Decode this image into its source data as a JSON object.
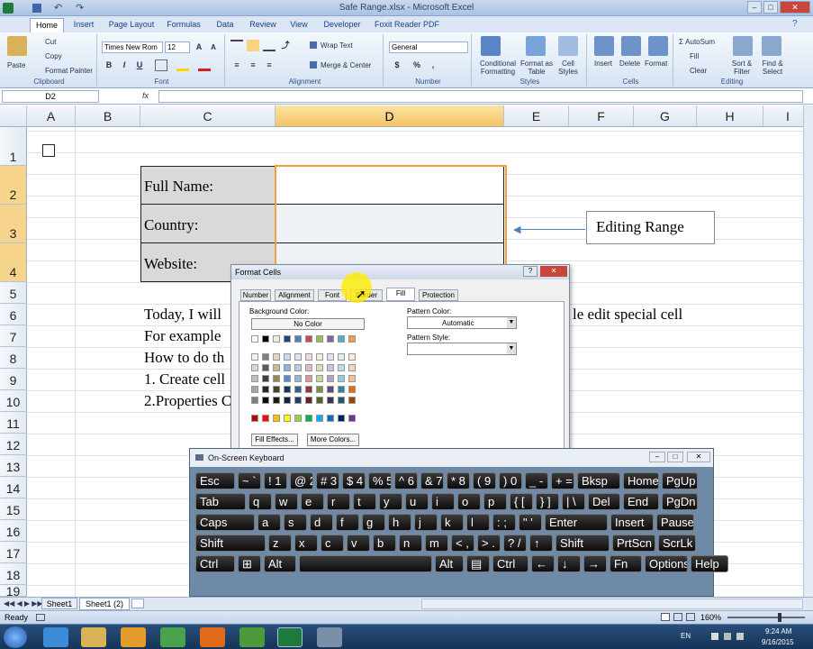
{
  "window": {
    "title": "Safe Range.xlsx - Microsoft Excel",
    "min": "–",
    "max": "□",
    "close": "✕"
  },
  "ribbon_tabs": [
    "Home",
    "Insert",
    "Page Layout",
    "Formulas",
    "Data",
    "Review",
    "View",
    "Developer",
    "Foxit Reader PDF"
  ],
  "ribbon": {
    "clipboard": {
      "paste": "Paste",
      "cut": "Cut",
      "copy": "Copy",
      "format_painter": "Format Painter",
      "label": "Clipboard"
    },
    "font": {
      "name": "Times New Rom",
      "size": "12",
      "bold": "B",
      "italic": "I",
      "underline": "U",
      "label": "Font",
      "grow": "A",
      "shrink": "A"
    },
    "alignment": {
      "wrap": "Wrap Text",
      "merge": "Merge & Center",
      "label": "Alignment"
    },
    "number": {
      "format": "General",
      "dollar": "$",
      "percent": "%",
      "comma": ",",
      "label": "Number"
    },
    "styles": {
      "conditional": "Conditional Formatting",
      "format_table": "Format as Table",
      "cell_styles": "Cell Styles",
      "label": "Styles"
    },
    "cells": {
      "insert": "Insert",
      "delete": "Delete",
      "format": "Format",
      "label": "Cells"
    },
    "editing": {
      "autosum": "AutoSum",
      "fill": "Fill",
      "clear": "Clear",
      "sort": "Sort & Filter",
      "find": "Find & Select",
      "label": "Editing"
    }
  },
  "formula_bar": {
    "name_box": "D2",
    "fx": "fx",
    "formula": ""
  },
  "columns": [
    "A",
    "B",
    "C",
    "D",
    "E",
    "F",
    "G",
    "H",
    "I"
  ],
  "rows": [
    "1",
    "2",
    "3",
    "4",
    "5",
    "6",
    "7",
    "8",
    "9",
    "10",
    "11",
    "12",
    "13",
    "14",
    "15",
    "16",
    "17",
    "18",
    "19"
  ],
  "cells": {
    "full_name": "Full Name:",
    "country": "Country:",
    "website": "Website:",
    "editing_range": "Editing Range",
    "line6_left": "Today, I will",
    "line6_right": "le edit special cell",
    "line7": "For example",
    "line8": "How to do th",
    "line9": "1. Create cell",
    "line10": "2.Properties C"
  },
  "format_cells_dialog": {
    "title": "Format Cells",
    "help": "?",
    "close": "✕",
    "tabs": [
      "Number",
      "Alignment",
      "Font",
      "Border",
      "Fill",
      "Protection"
    ],
    "active_tab": "Fill",
    "background_color_label": "Background Color:",
    "no_color": "No Color",
    "pattern_color_label": "Pattern Color:",
    "pattern_color_value": "Automatic",
    "pattern_style_label": "Pattern Style:",
    "fill_effects": "Fill Effects...",
    "more_colors": "More Colors..."
  },
  "osk": {
    "title": "On-Screen Keyboard",
    "rows": [
      [
        "Esc",
        "~ `",
        "! 1",
        "@ 2",
        "# 3",
        "$ 4",
        "% 5",
        "^ 6",
        "& 7",
        "* 8",
        "( 9",
        ") 0",
        "_ -",
        "+ =",
        "Bksp",
        "Home",
        "PgUp"
      ],
      [
        "Tab",
        "q",
        "w",
        "e",
        "r",
        "t",
        "y",
        "u",
        "i",
        "o",
        "p",
        "{ [",
        "} ]",
        "| \\",
        "Del",
        "End",
        "PgDn"
      ],
      [
        "Caps",
        "a",
        "s",
        "d",
        "f",
        "g",
        "h",
        "j",
        "k",
        "l",
        ": ;",
        "\" '",
        "Enter",
        "Insert",
        "Pause"
      ],
      [
        "Shift",
        "z",
        "x",
        "c",
        "v",
        "b",
        "n",
        "m",
        "< ,",
        "> .",
        "? /",
        "↑",
        "Shift",
        "PrtScn",
        "ScrLk"
      ],
      [
        "Ctrl",
        "⊞",
        "Alt",
        "",
        "Alt",
        "▤",
        "Ctrl",
        "←",
        "↓",
        "→",
        "Fn",
        "Options",
        "Help"
      ]
    ]
  },
  "sheet_tabs": [
    "Sheet1",
    "Sheet1 (2)"
  ],
  "status": {
    "ready": "Ready",
    "zoom": "160%"
  },
  "taskbar": {
    "time": "9:24 AM",
    "date": "9/16/2015",
    "lang": "EN"
  },
  "colors": {
    "selection": "#f6a03a",
    "dialog_bg": "#f0f0f0",
    "osk_bg": "#6f8aa6"
  }
}
